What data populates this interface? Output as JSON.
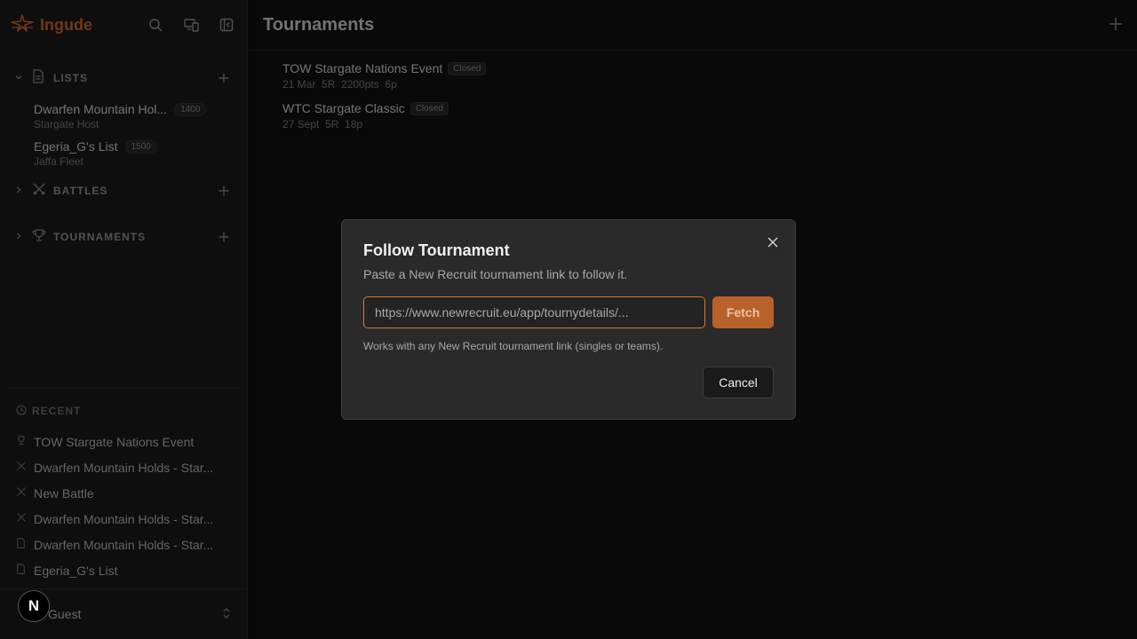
{
  "app": {
    "name": "Ingude"
  },
  "sidebar": {
    "sections": {
      "lists": {
        "title": "LISTS"
      },
      "battles": {
        "title": "BATTLES"
      },
      "tournaments": {
        "title": "TOURNAMENTS"
      }
    },
    "lists": [
      {
        "name": "Dwarfen Mountain Hol...",
        "points": "1400",
        "army": "Stargate Host"
      },
      {
        "name": "Egeria_G's List",
        "points": "1500",
        "army": "Jaffa Fleet"
      }
    ],
    "recent": {
      "title": "RECENT",
      "items": [
        {
          "icon": "trophy-icon",
          "label": "TOW Stargate Nations Event"
        },
        {
          "icon": "crossed-swords-icon",
          "label": "Dwarfen Mountain Holds - Star..."
        },
        {
          "icon": "crossed-swords-icon",
          "label": "New Battle"
        },
        {
          "icon": "crossed-swords-icon",
          "label": "Dwarfen Mountain Holds - Star..."
        },
        {
          "icon": "document-icon",
          "label": "Dwarfen Mountain Holds - Star..."
        },
        {
          "icon": "document-icon",
          "label": "Egeria_G's List"
        }
      ]
    },
    "user": {
      "name": "Guest",
      "badge": "N"
    }
  },
  "main": {
    "title": "Tournaments",
    "tournaments": [
      {
        "name": "TOW Stargate Nations Event",
        "status": "Closed",
        "meta": "21 Mar  5R  2200pts  6p"
      },
      {
        "name": "WTC Stargate Classic",
        "status": "Closed",
        "meta": "27 Sept  5R  18p"
      }
    ]
  },
  "dialog": {
    "title": "Follow Tournament",
    "description": "Paste a New Recruit tournament link to follow it.",
    "input_placeholder": "https://www.newrecruit.eu/app/tournydetails/...",
    "input_value": "",
    "fetch_label": "Fetch",
    "hint": "Works with any New Recruit tournament link (singles or teams).",
    "cancel_label": "Cancel"
  },
  "colors": {
    "accent": "#e0722e",
    "fetch_bg": "#b8612b",
    "background": "#121212",
    "sidebar_bg": "#1c1c1c",
    "dialog_bg": "#2a2a2a"
  }
}
